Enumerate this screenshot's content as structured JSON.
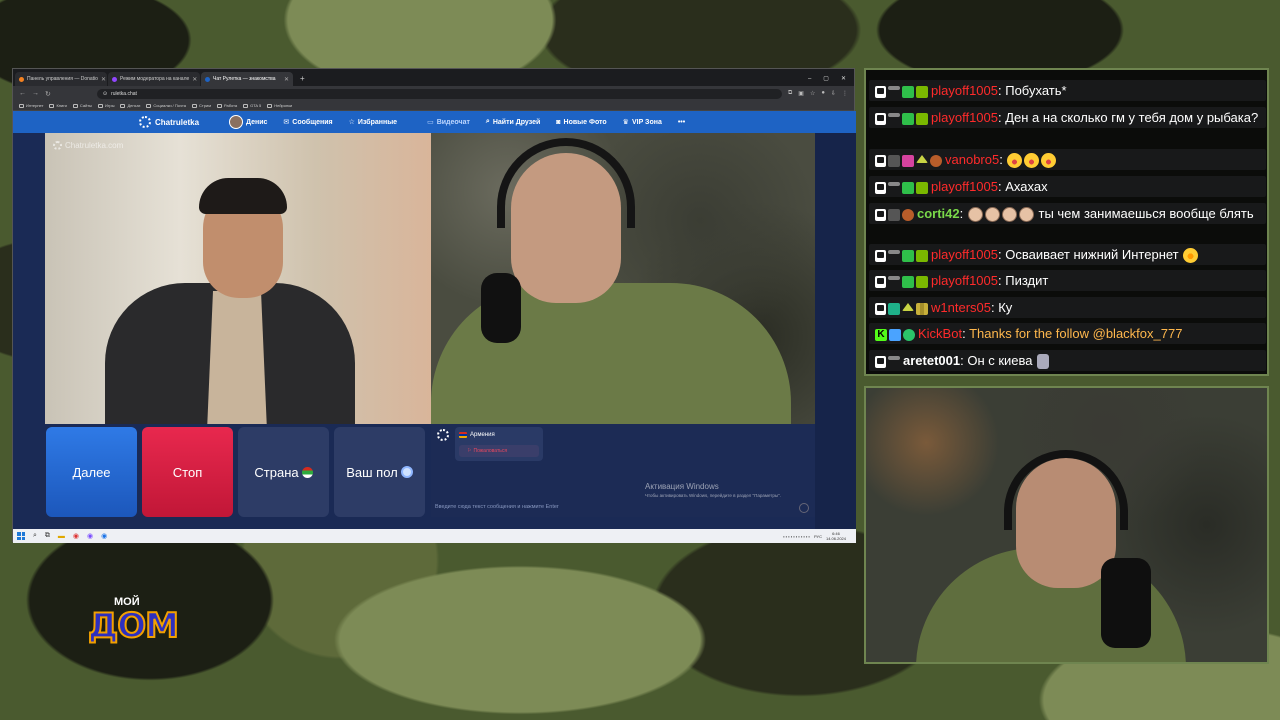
{
  "browser": {
    "tabs": [
      {
        "label": "Панель управления — Donatio",
        "color": "#f58220"
      },
      {
        "label": "Режим модератора на канале",
        "color": "#9146ff"
      },
      {
        "label": "Чат Рулетка — знакомства",
        "color": "#1e63c4"
      }
    ],
    "new_tab": "+",
    "window_controls": [
      "–",
      "▢",
      "✕"
    ],
    "address": "ruletka.chat",
    "bookmarks": [
      "Интернет",
      "Книги",
      "Сайты",
      "Игры",
      "Деньги",
      "Социалки / Почта",
      "Стрим",
      "Работа",
      "GTA 5",
      "Нейронки"
    ]
  },
  "site": {
    "brand": "Chatruletka",
    "user": "Денис",
    "nav": [
      "Сообщения",
      "Избранные",
      "Видеочат",
      "Найти Друзей",
      "Новые Фото",
      "VIP Зона",
      "•••"
    ],
    "watermark": "Chatruletka.com",
    "buttons": {
      "next": "Далее",
      "stop": "Стоп",
      "country": "Страна",
      "gender": "Ваш пол"
    },
    "partner_country": "Армения",
    "report_label": "Пожаловаться",
    "activation_title": "Активация Windows",
    "activation_sub": "Чтобы активировать Windows, перейдите в раздел \"Параметры\".",
    "message_placeholder": "Введите сюда текст сообщения и нажмите Enter"
  },
  "taskbar": {
    "lang": "РУС",
    "time": "6:46",
    "date": "14.06.2024"
  },
  "chat": {
    "messages": [
      {
        "user": "playoff1005",
        "color": "red",
        "text": "Побухать*",
        "badges": [
          "twitch",
          "bar",
          "check",
          "rl"
        ]
      },
      {
        "user": "playoff1005",
        "color": "red",
        "text": "Ден а на сколько гм у тебя дом у рыбака?",
        "badges": [
          "twitch",
          "bar",
          "check",
          "rl"
        ]
      },
      {
        "user": "vanobro5",
        "color": "red",
        "text": "",
        "badges": [
          "twitch",
          "cap",
          "gem",
          "up",
          "pet"
        ],
        "emotes": [
          "laugh",
          "laugh",
          "laugh"
        ]
      },
      {
        "user": "playoff1005",
        "color": "red",
        "text": "Ахахах",
        "badges": [
          "twitch",
          "bar",
          "check",
          "rl"
        ]
      },
      {
        "user": "corti42",
        "color": "green",
        "text": "ты чем занимаешься вообще блять",
        "badges": [
          "twitch",
          "cap",
          "pet"
        ],
        "emotes": [
          "face",
          "face",
          "face",
          "face"
        ]
      },
      {
        "user": "playoff1005",
        "color": "red",
        "text": "Осваивает нижний Интернет",
        "badges": [
          "twitch",
          "bar",
          "check",
          "rl"
        ],
        "emotes_after": [
          "rofl"
        ]
      },
      {
        "user": "playoff1005",
        "color": "red",
        "text": "Пиздит",
        "badges": [
          "twitch",
          "bar",
          "check",
          "rl"
        ]
      },
      {
        "user": "w1nters05",
        "color": "red",
        "text": "Ку",
        "badges": [
          "twitch",
          "teal",
          "up",
          "bars"
        ]
      },
      {
        "user": "KickBot",
        "color": "red",
        "text": "Thanks for the follow @blackfox_777",
        "text_color": "#ffb84d",
        "badges": [
          "kick",
          "sword",
          "green-check"
        ]
      },
      {
        "user": "aretet001",
        "color": "white",
        "text": "Он с киева",
        "badges": [
          "twitch",
          "bar"
        ],
        "emotes_after": [
          "hands"
        ]
      }
    ]
  },
  "logo": {
    "top": "МОЙ",
    "main": "ДОМ"
  },
  "colors": {
    "accent_green": "#6f8550",
    "site_blue": "#1e63c4",
    "stop_red": "#e8284e",
    "next_blue": "#2f7ae6"
  }
}
